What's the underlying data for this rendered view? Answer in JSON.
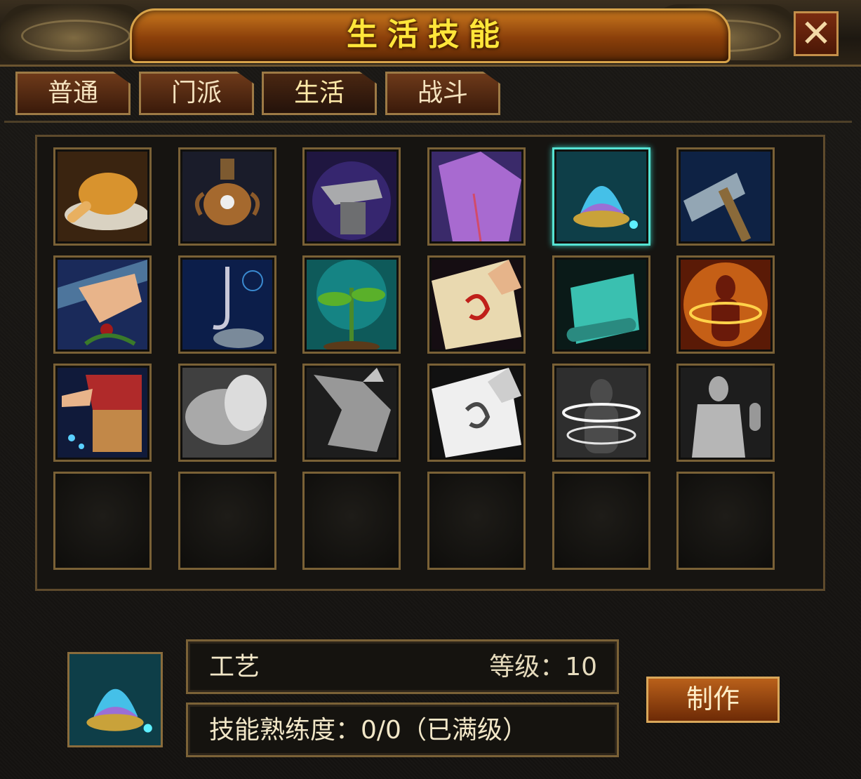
{
  "window": {
    "title": "生活技能",
    "close_label": "✕"
  },
  "tabs": [
    {
      "label": "普通",
      "active": false
    },
    {
      "label": "门派",
      "active": false
    },
    {
      "label": "生活",
      "active": true
    },
    {
      "label": "战斗",
      "active": false
    }
  ],
  "skills": [
    {
      "icon": "roast-chicken-icon",
      "learned": true
    },
    {
      "icon": "alchemy-furnace-icon",
      "learned": true
    },
    {
      "icon": "anvil-icon",
      "learned": true
    },
    {
      "icon": "tailoring-robe-icon",
      "learned": true
    },
    {
      "icon": "crafting-orb-icon",
      "learned": true,
      "selected": true
    },
    {
      "icon": "mining-pickaxe-icon",
      "learned": true
    },
    {
      "icon": "herb-picking-icon",
      "learned": true
    },
    {
      "icon": "fishing-hook-icon",
      "learned": true
    },
    {
      "icon": "seedling-icon",
      "learned": true
    },
    {
      "icon": "talisman-scroll-icon",
      "learned": true
    },
    {
      "icon": "jade-scroll-icon",
      "learned": true
    },
    {
      "icon": "fire-aura-body-icon",
      "learned": true
    },
    {
      "icon": "embroidery-icon",
      "learned": true
    },
    {
      "icon": "stone-carving-icon",
      "learned": false
    },
    {
      "icon": "roast-bird-icon",
      "learned": false
    },
    {
      "icon": "talisman-scroll-icon",
      "learned": false
    },
    {
      "icon": "wind-aura-body-icon",
      "learned": false
    },
    {
      "icon": "muscle-body-icon",
      "learned": false
    }
  ],
  "empty_slots": 6,
  "selected_skill": {
    "icon": "crafting-orb-icon",
    "name": "工艺",
    "level_text": "等级：10",
    "proficiency_text": "技能熟练度：0/0（已满级）"
  },
  "make_button": "制作",
  "colors": {
    "title": "#ffe63a",
    "frame": "#7a6136",
    "selected": "#56e3d3"
  }
}
